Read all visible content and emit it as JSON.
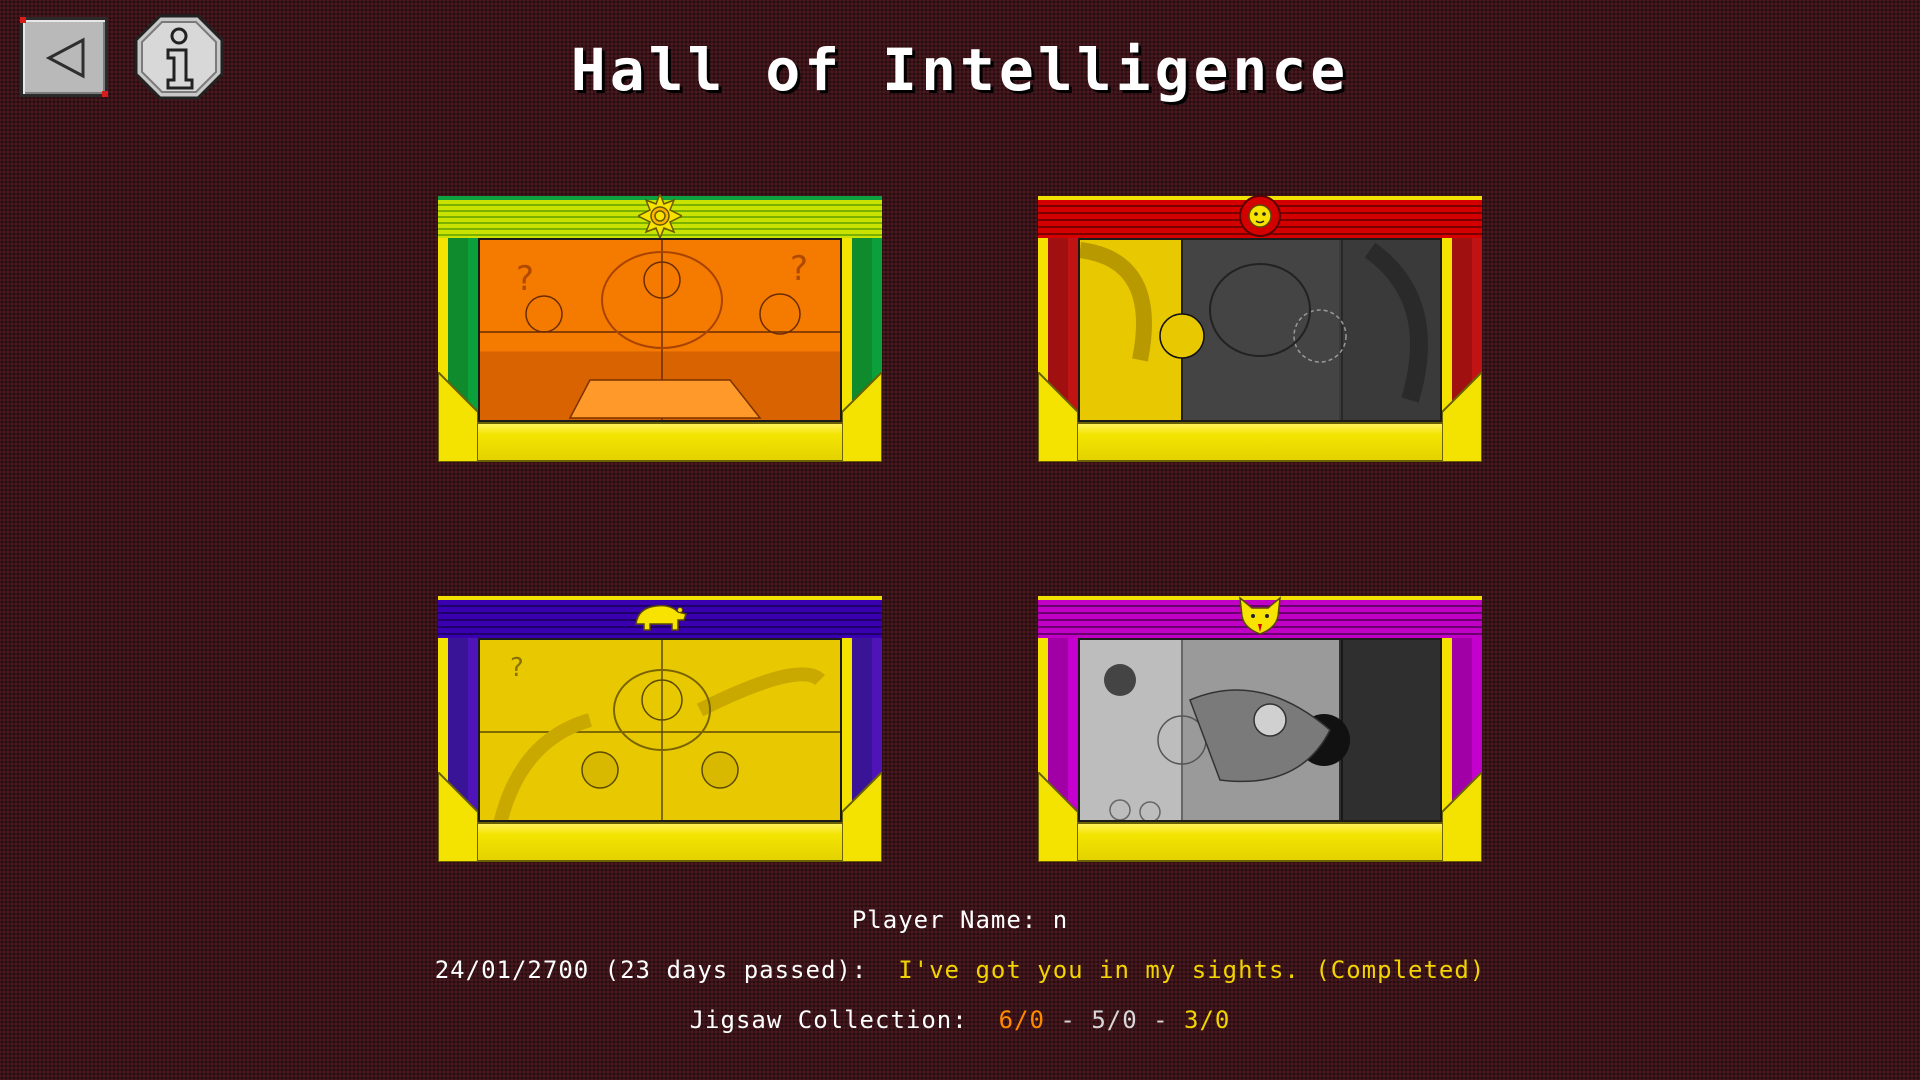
{
  "screen": {
    "title": "Hall of Intelligence"
  },
  "buttons": {
    "back_icon": "back-arrow-icon",
    "info_icon": "info-icon"
  },
  "frames": [
    {
      "theme": "green",
      "emblem": "sun-icon",
      "picture": "orange-puzzle"
    },
    {
      "theme": "red",
      "emblem": "lion-icon",
      "picture": "partial-puzzle-gray"
    },
    {
      "theme": "indigo",
      "emblem": "bear-icon",
      "picture": "yellow-puzzle"
    },
    {
      "theme": "magenta",
      "emblem": "wildcat-icon",
      "picture": "partial-puzzle-gray"
    }
  ],
  "info": {
    "player_label": "Player Name: ",
    "player_name": "n",
    "date_line": "24/01/2700 (23 days passed):  ",
    "status": "I've got you in my sights. (Completed)",
    "jigsaw_label": "Jigsaw Collection:  ",
    "jigsaw_a": "6/0",
    "sep1": " - ",
    "jigsaw_b": "5/0",
    "sep2": " - ",
    "jigsaw_c": "3/0"
  },
  "colors": {
    "background": "#3a1419",
    "status_text": "#f2d400",
    "jigsaw_a": "#ff8a00",
    "jigsaw_b": "#d8d8d8",
    "jigsaw_c": "#f2d400"
  }
}
